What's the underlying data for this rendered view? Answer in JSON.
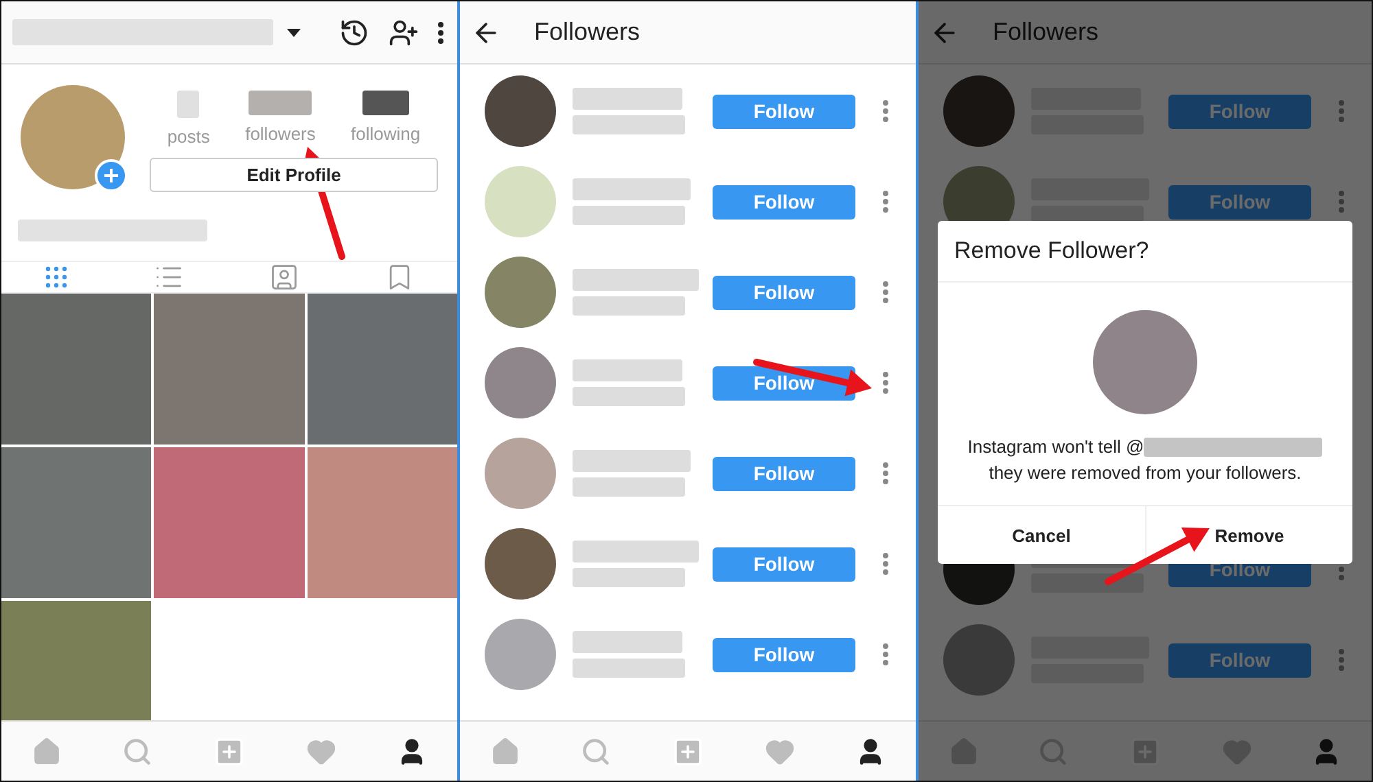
{
  "profile": {
    "top_bar": {
      "icons": [
        {
          "kind": "history"
        },
        {
          "kind": "add-person"
        },
        {
          "kind": "more"
        }
      ]
    },
    "stats": [
      {
        "label": "posts"
      },
      {
        "label": "followers"
      },
      {
        "label": "following"
      }
    ],
    "edit_button": "Edit Profile",
    "tabs": [
      {
        "kind": "grid",
        "selected": true
      },
      {
        "kind": "list",
        "selected": false
      },
      {
        "kind": "tagged",
        "selected": false
      },
      {
        "kind": "saved",
        "selected": false
      }
    ],
    "photos": [
      {
        "color": "#666866"
      },
      {
        "color": "#7d7570"
      },
      {
        "color": "#6a6d70"
      },
      {
        "color": "#6f7371"
      },
      {
        "color": "#c06a78"
      },
      {
        "color": "#c08a80"
      },
      {
        "color": "#7a7f55"
      }
    ],
    "bottom_nav": [
      {
        "kind": "home",
        "selected": false
      },
      {
        "kind": "search",
        "selected": false
      },
      {
        "kind": "add",
        "selected": false
      },
      {
        "kind": "heart",
        "selected": false
      },
      {
        "kind": "profile",
        "selected": true
      }
    ]
  },
  "followers": {
    "title": "Followers",
    "rows": [
      {
        "color": "#4f463f",
        "button": "Follow"
      },
      {
        "color": "#d8e0c2",
        "button": "Follow"
      },
      {
        "color": "#858566",
        "button": "Follow"
      },
      {
        "color": "#8f868c",
        "button": "Follow"
      },
      {
        "color": "#b6a49c",
        "button": "Follow"
      },
      {
        "color": "#6b5b48",
        "button": "Follow"
      },
      {
        "color": "#a9a9ad",
        "button": "Follow"
      }
    ],
    "bottom_nav": [
      {
        "kind": "home",
        "selected": false
      },
      {
        "kind": "search",
        "selected": false
      },
      {
        "kind": "add",
        "selected": false
      },
      {
        "kind": "heart",
        "selected": false
      },
      {
        "kind": "profile",
        "selected": true
      }
    ]
  },
  "remove_screen": {
    "title": "Followers",
    "rows_above": [
      {
        "button": "Follow"
      },
      {
        "button": "Follow"
      }
    ],
    "dialog": {
      "title": "Remove Follower?",
      "message_before": "Instagram won't tell @",
      "message_after": "they were removed from your followers.",
      "buttons": [
        "Cancel",
        "Remove"
      ]
    },
    "rows_below": [
      {
        "button": "Follow"
      },
      {
        "button": "Follow"
      }
    ],
    "bottom_nav": [
      {
        "kind": "home",
        "selected": false
      },
      {
        "kind": "search",
        "selected": false
      },
      {
        "kind": "add",
        "selected": false
      },
      {
        "kind": "heart",
        "selected": false
      },
      {
        "kind": "profile",
        "selected": true
      }
    ]
  }
}
